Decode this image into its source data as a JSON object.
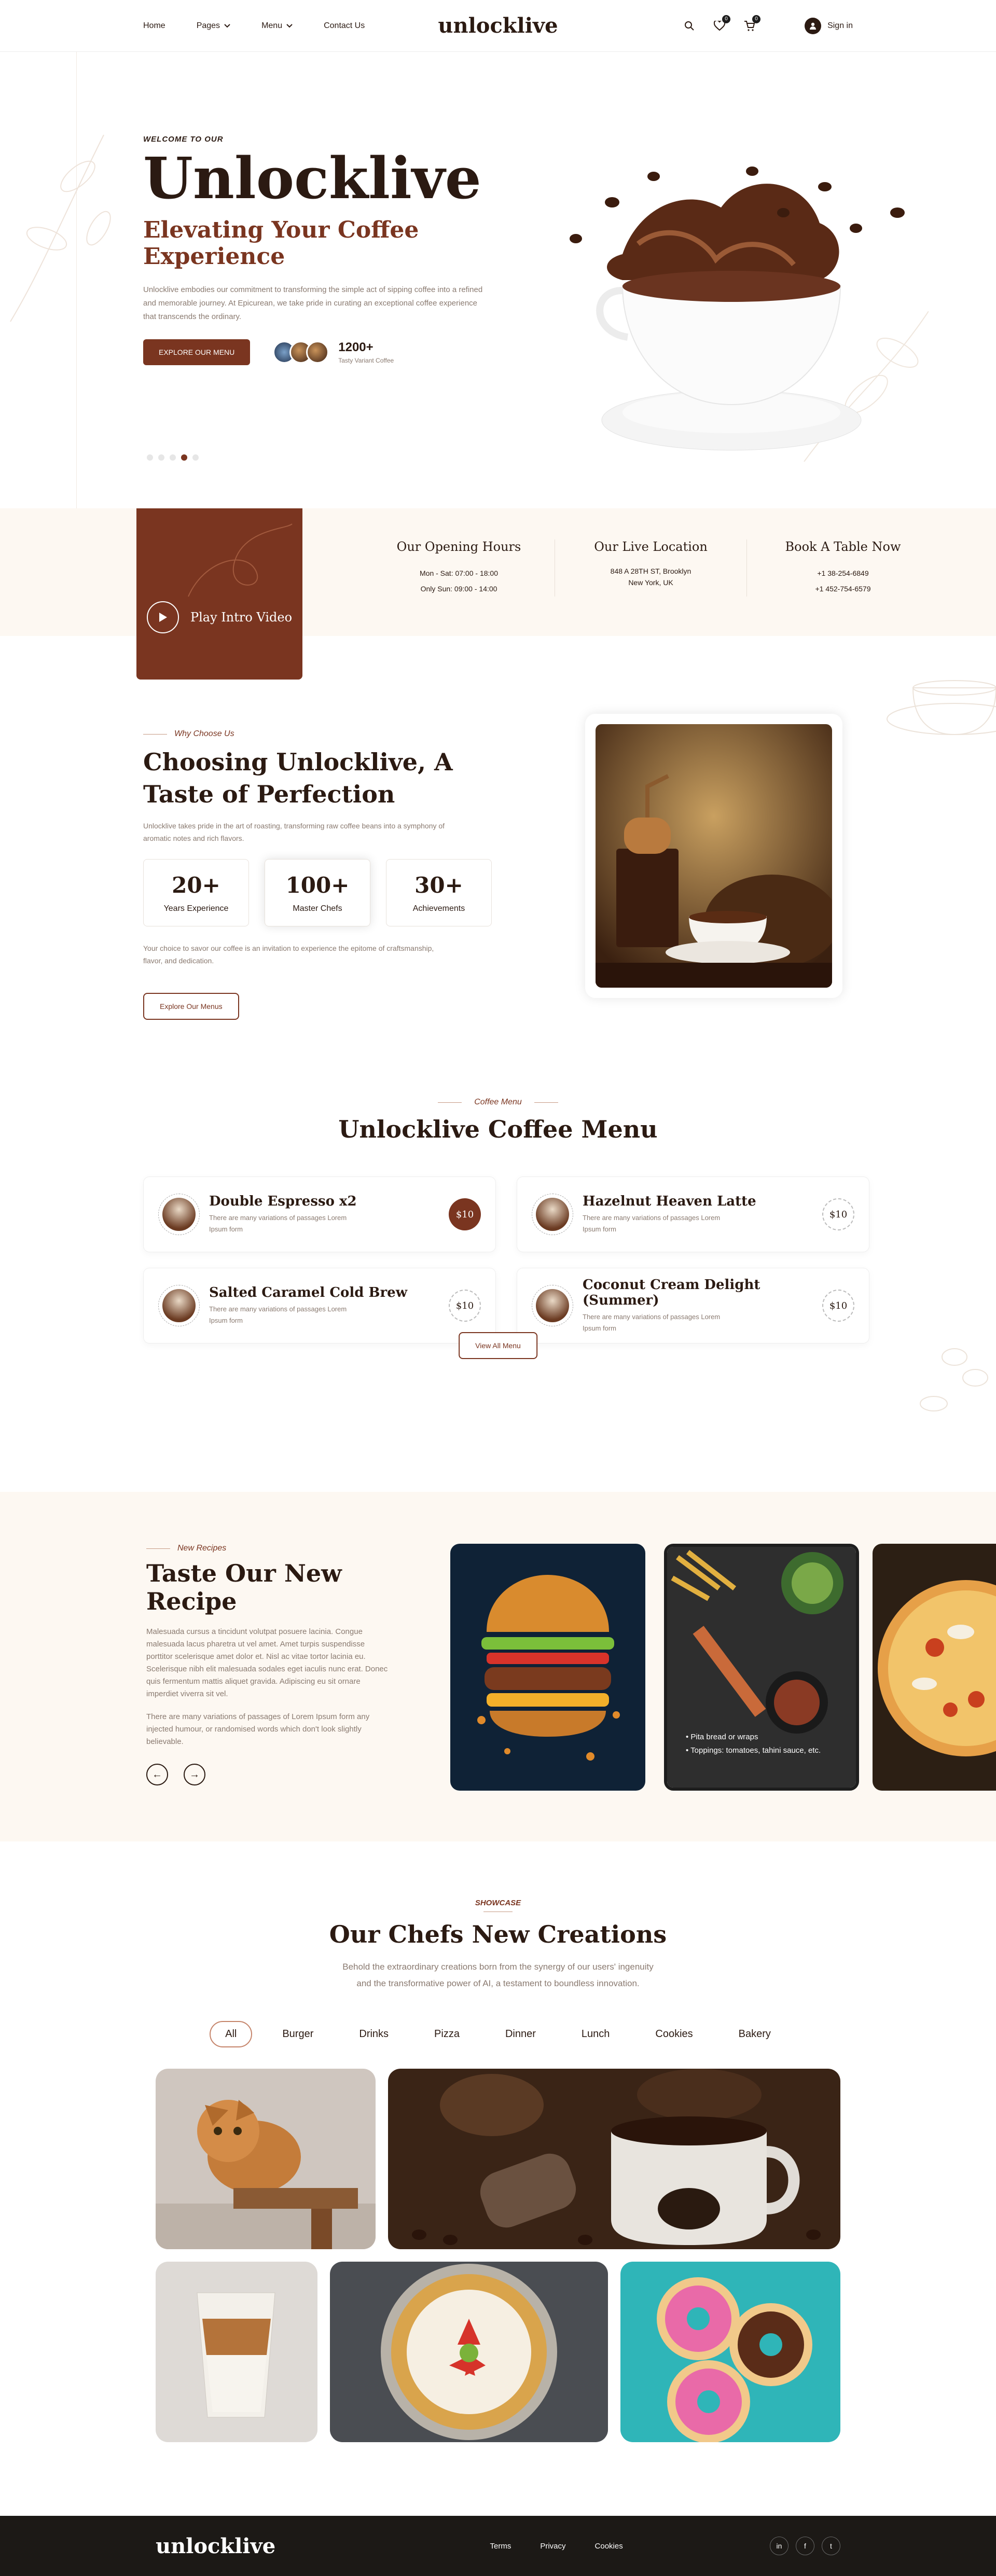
{
  "header": {
    "nav": [
      "Home",
      "Pages",
      "Menu",
      "Contact Us"
    ],
    "logo": "unlocklive",
    "wishlist_count": "0",
    "cart_count": "0",
    "signin": "Sign in"
  },
  "hero": {
    "eyebrow": "WELCOME TO OUR",
    "title": "Unlocklive",
    "subtitle": "Elevating Your Coffee Experience",
    "text": "Unlocklive embodies our commitment to transforming the simple act of sipping coffee into a refined and memorable journey. At Epicurean, we take pride in curating an exceptional coffee experience that transcends the ordinary.",
    "button": "EXPLORE OUR MENU",
    "stat_value": "1200+",
    "stat_label": "Tasty Variant Coffee",
    "slides": 5,
    "active_slide": 4
  },
  "band": {
    "video_label": "Play Intro Video",
    "cols": [
      {
        "title": "Our Opening Hours",
        "line1": "Mon - Sat: 07:00 - 18:00",
        "line2": "Only Sun: 09:00 - 14:00"
      },
      {
        "title": "Our Live Location",
        "line1": "848 A 28TH ST, Brooklyn",
        "line2": "New York, UK"
      },
      {
        "title": "Book A Table Now",
        "line1": "+1 38-254-6849",
        "line2": "+1 452-754-6579"
      }
    ]
  },
  "why": {
    "sub": "Why Choose Us",
    "title": "Choosing Unlocklive, A Taste of Perfection",
    "text": "Unlocklive takes pride in the art of roasting, transforming raw coffee beans into a symphony of aromatic notes and rich flavors.",
    "stats": [
      {
        "value": "20+",
        "label": "Years Experience"
      },
      {
        "value": "100+",
        "label": "Master Chefs"
      },
      {
        "value": "30+",
        "label": "Achievements"
      }
    ],
    "text2": "Your choice to savor our coffee is an invitation to experience the epitome of craftsmanship, flavor, and dedication.",
    "button": "Explore Our Menus"
  },
  "menu": {
    "sub": "Coffee Menu",
    "title": "Unlocklive Coffee Menu",
    "items": [
      {
        "name": "Double Espresso x2",
        "desc": "There are many variations of passages Lorem Ipsum form",
        "price": "$10"
      },
      {
        "name": "Hazelnut Heaven Latte",
        "desc": "There are many variations of passages Lorem Ipsum form",
        "price": "$10"
      },
      {
        "name": "Salted Caramel Cold Brew",
        "desc": "There are many variations of passages Lorem Ipsum form",
        "price": "$10"
      },
      {
        "name": "Coconut Cream Delight (Summer)",
        "desc": "There are many variations of passages Lorem Ipsum form",
        "price": "$10"
      }
    ],
    "button": "View All Menu"
  },
  "recipe": {
    "sub": "New Recipes",
    "title": "Taste Our New Recipe",
    "p1": "Malesuada cursus a tincidunt volutpat posuere lacinia. Congue malesuada lacus pharetra ut vel amet. Amet turpis suspendisse porttitor scelerisque amet dolor et. Nisl ac vitae tortor lacinia eu. Scelerisque nibh elit malesuada sodales eget iaculis nunc erat. Donec quis fermentum mattis aliquet gravida. Adipiscing eu sit ornare imperdiet viverra sit vel.",
    "p2": "There are many variations of passages of Lorem Ipsum form any injected humour, or randomised words which don't look slightly believable.",
    "card_bullets": [
      "Pita bread or wraps",
      "Toppings: tomatoes, tahini sauce, etc."
    ]
  },
  "showcase": {
    "sub": "SHOWCASE",
    "title": "Our Chefs New Creations",
    "desc1": "Behold the extraordinary creations born from the synergy of our users' ingenuity",
    "desc2": "and the transformative power of AI, a testament to boundless innovation.",
    "filters": [
      "All",
      "Burger",
      "Drinks",
      "Pizza",
      "Dinner",
      "Lunch",
      "Cookies",
      "Bakery"
    ]
  },
  "footer": {
    "logo": "unlocklive",
    "links": [
      "Terms",
      "Privacy",
      "Cookies"
    ],
    "social": [
      "in",
      "f",
      "t"
    ]
  }
}
